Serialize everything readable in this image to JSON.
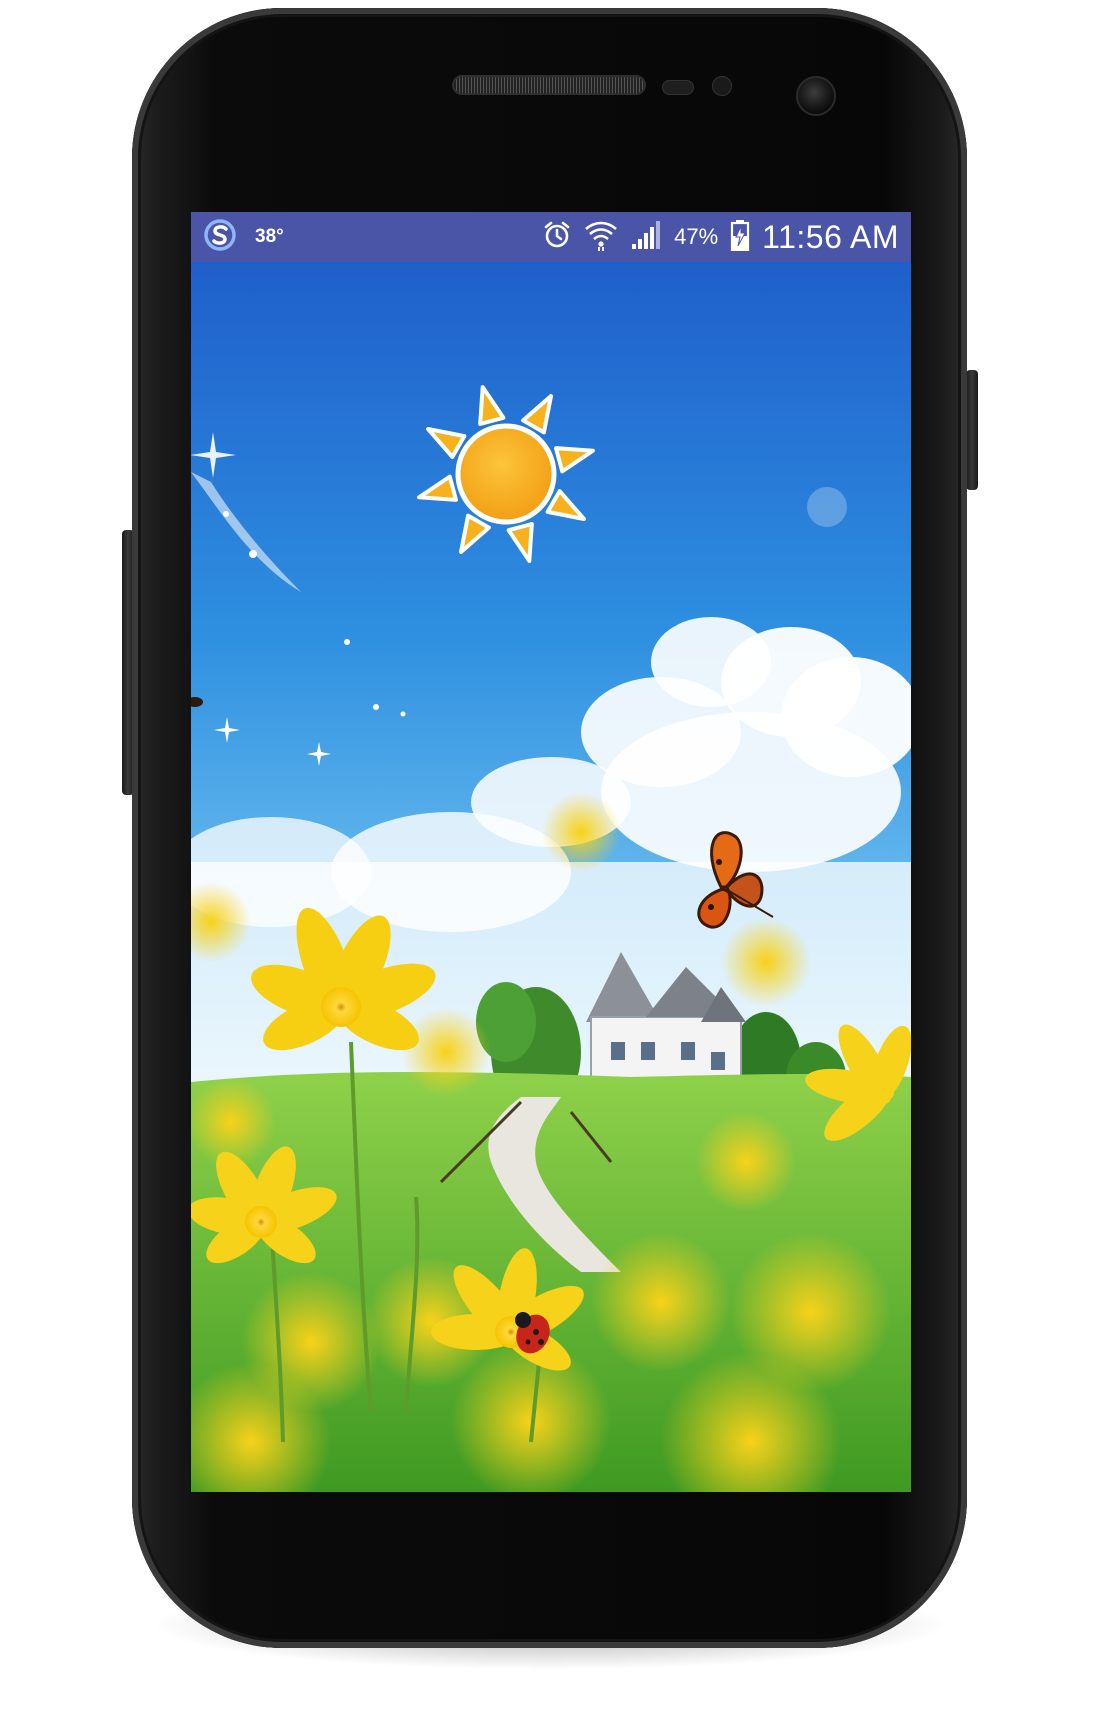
{
  "status_bar": {
    "temperature": "38°",
    "battery_percent": "47%",
    "time": "11:56 AM"
  },
  "icons": {
    "app": "s-logo-icon",
    "alarm": "alarm-icon",
    "wifi": "wifi-icon",
    "signal": "signal-icon",
    "battery": "battery-charging-icon"
  },
  "colors": {
    "status_bar": "#4a55a8",
    "sky_top": "#1f5fcb",
    "sky_bottom": "#eaf4fb",
    "sun": "#f7b11d",
    "grass": "#6fbe3a",
    "flowers": "#f7d21a"
  }
}
